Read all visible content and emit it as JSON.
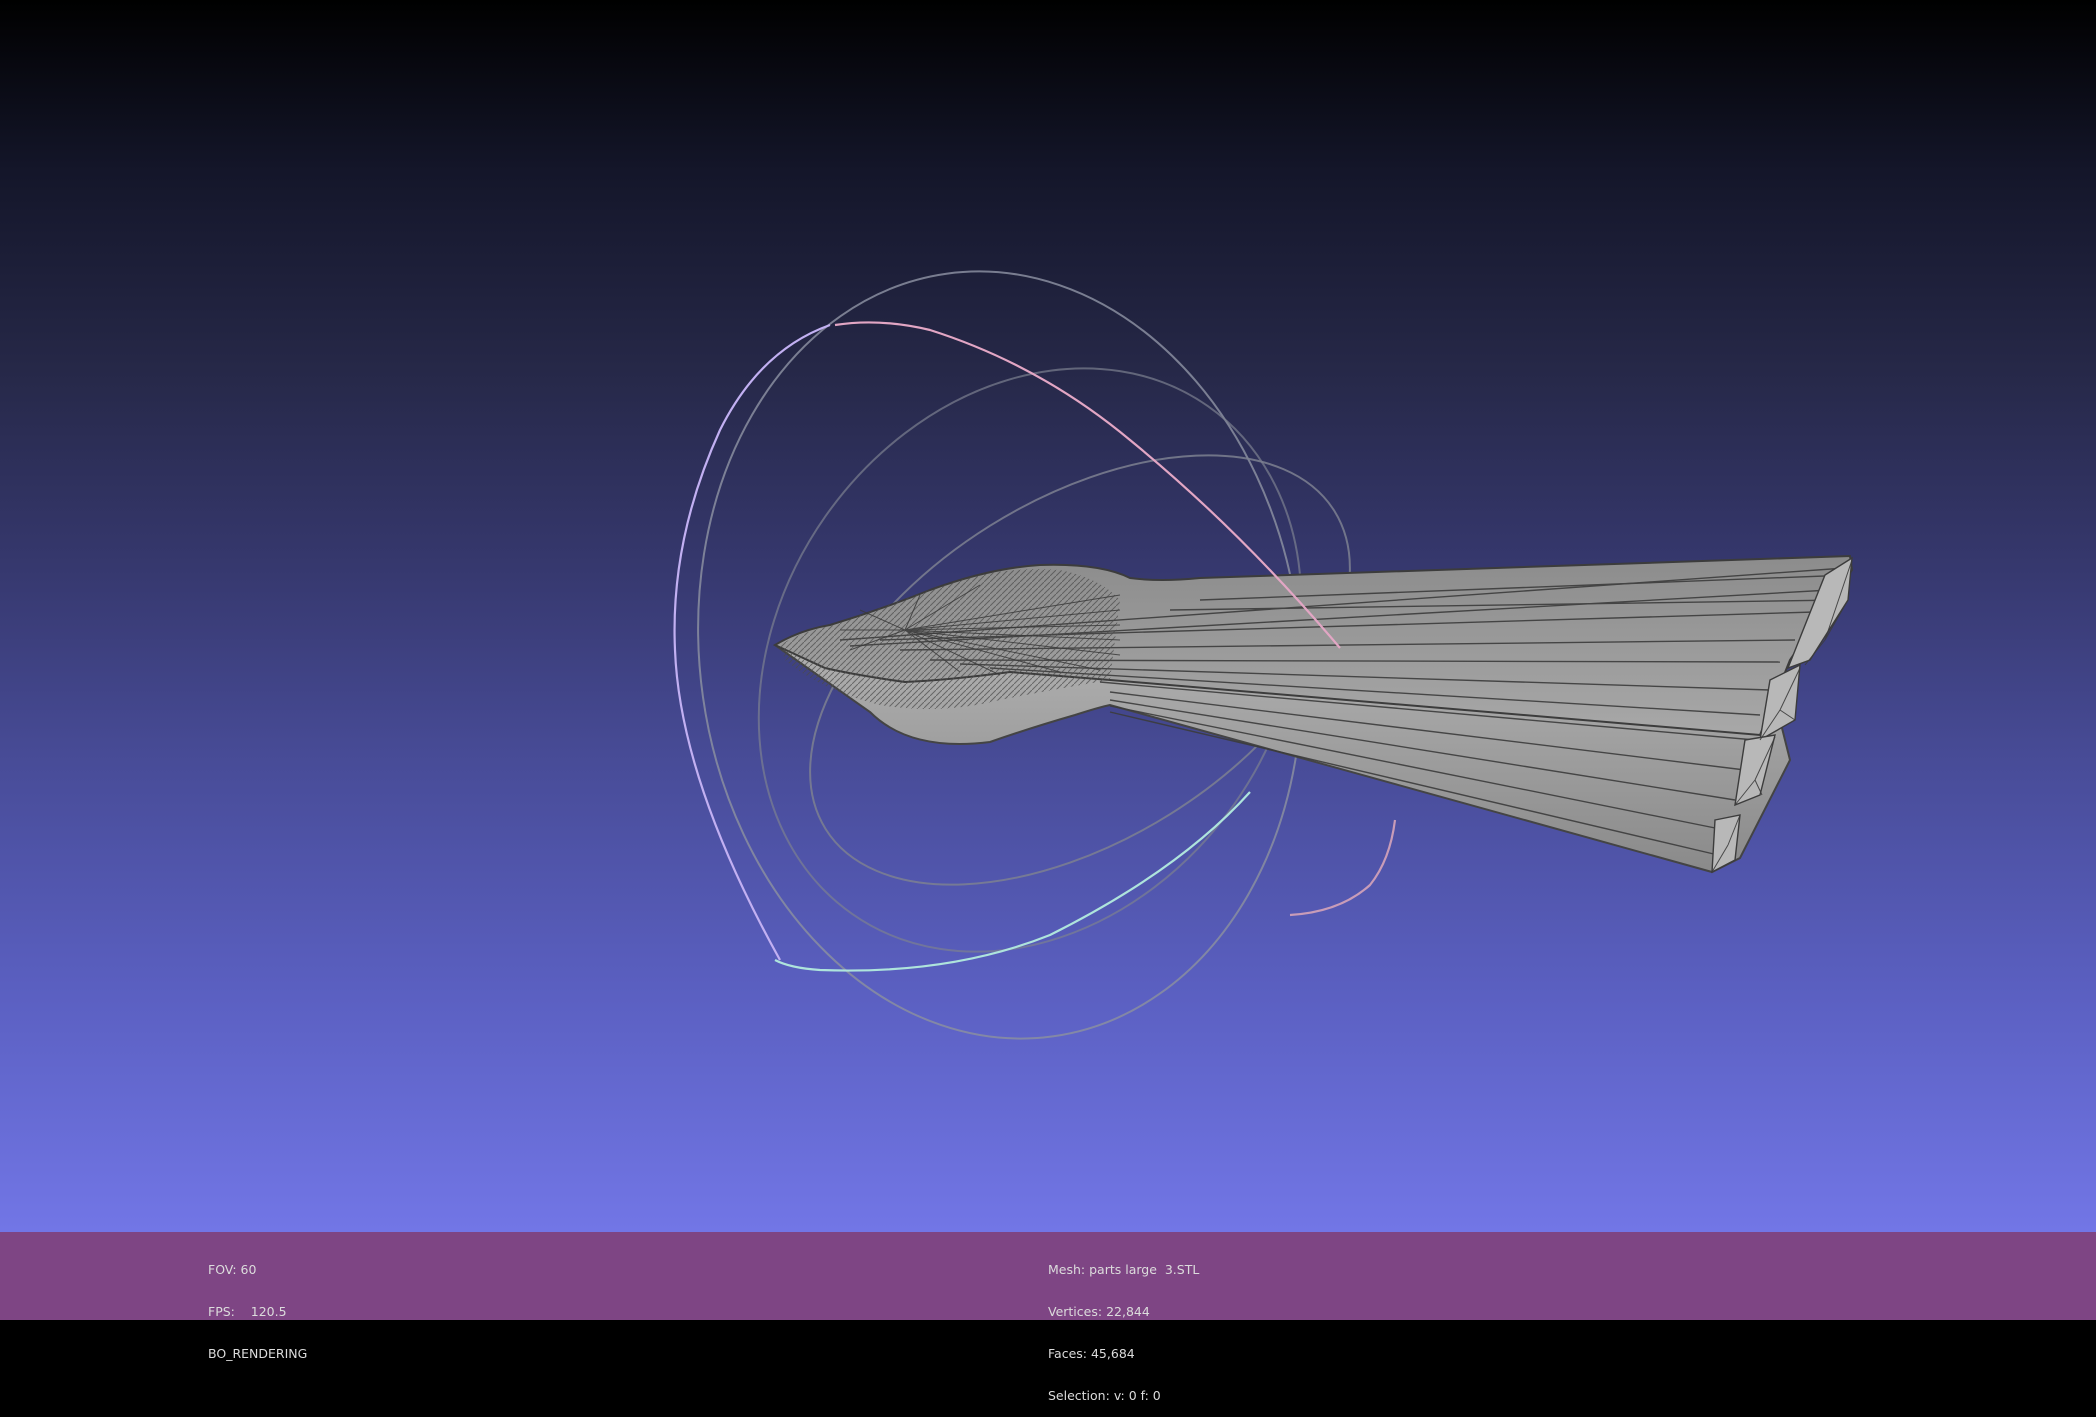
{
  "info_left": {
    "fov_label": "FOV:",
    "fov_value": "60",
    "fps_label": "FPS:",
    "fps_value": "120.5",
    "render_mode": "BO_RENDERING"
  },
  "info_center": {
    "mesh_label": "Mesh:",
    "mesh_value": "parts large  3.STL",
    "vertices_label": "Vertices:",
    "vertices_value": "22,844",
    "faces_label": "Faces:",
    "faces_value": "45,684",
    "selection_label": "Selection:",
    "selection_value": "v: 0 f: 0"
  },
  "colors": {
    "status_bar": "#7e4584",
    "mesh_fill": "#9a9a9a",
    "mesh_edge": "#3c3c3c",
    "trackball_red": "#e0a8c0",
    "trackball_green": "#a8e0d8",
    "trackball_blue": "#c0b0f0"
  },
  "icons": [
    "trackball-gizmo",
    "mesh-model"
  ]
}
